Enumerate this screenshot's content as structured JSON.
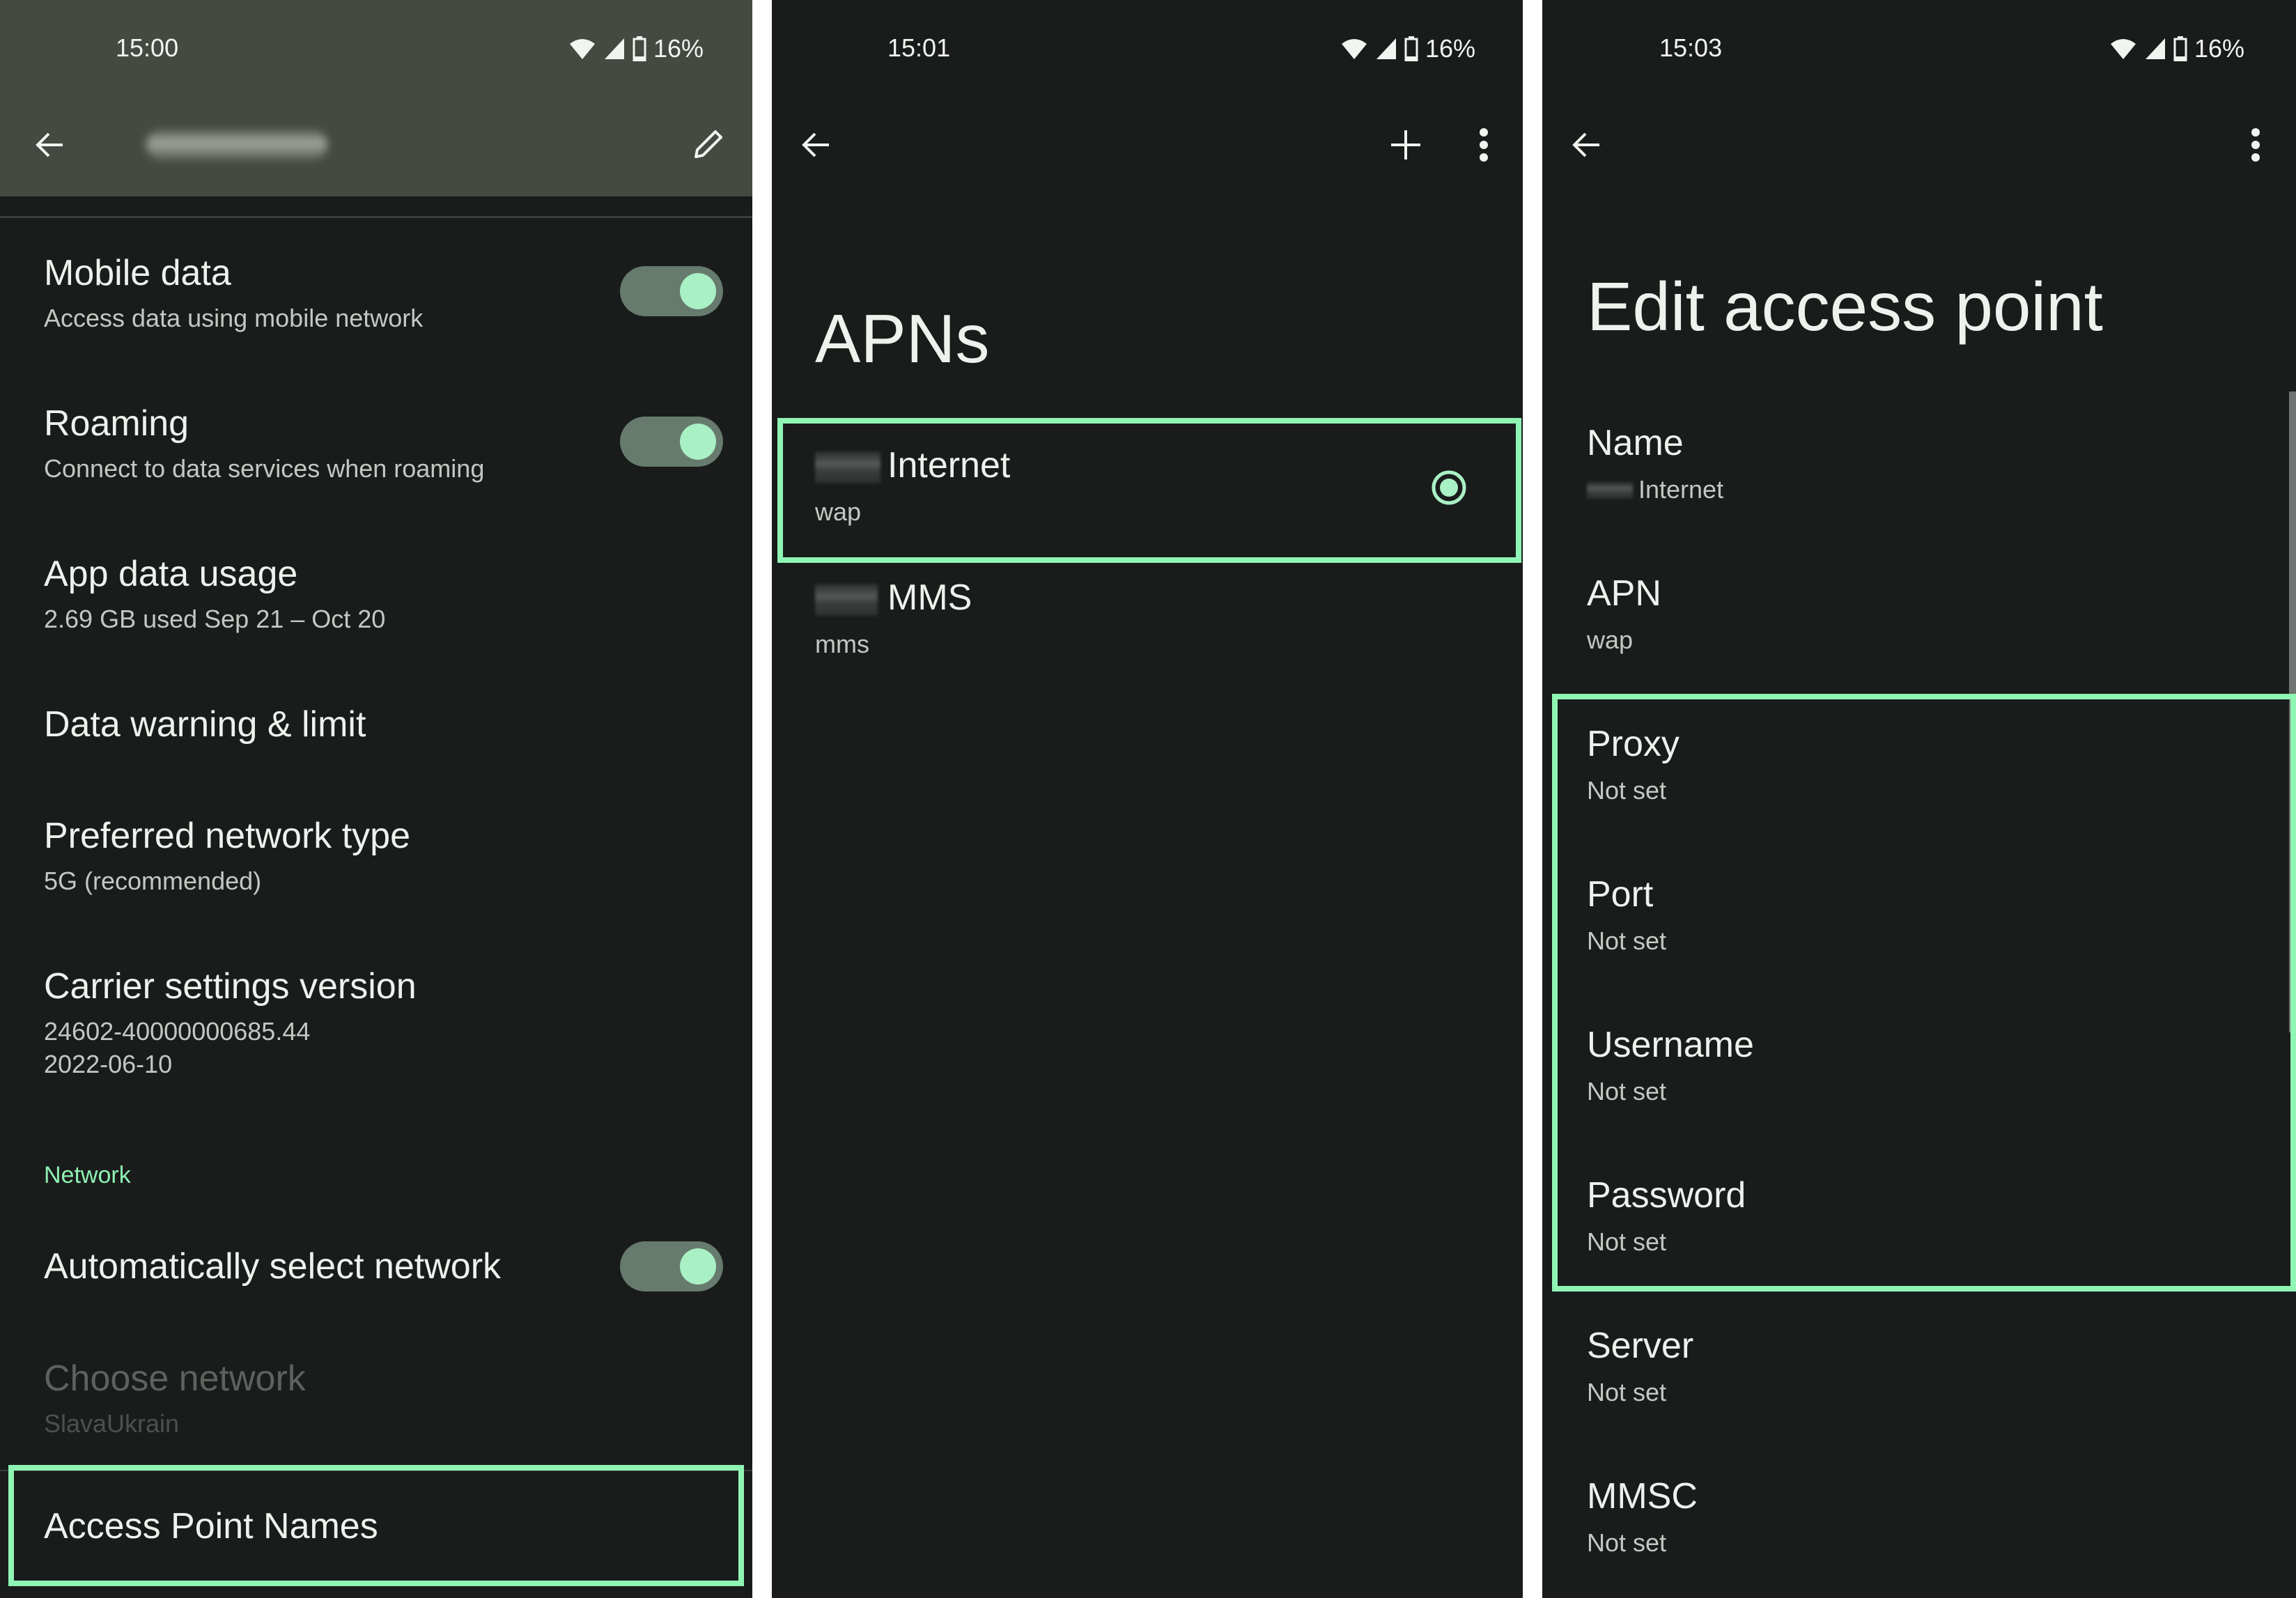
{
  "accent_color": "#8ff4b4",
  "screens": [
    {
      "status": {
        "time": "15:00",
        "battery": "16%"
      },
      "toolbar": {
        "back_icon": "arrow-back-icon",
        "title_redacted": true,
        "action_icon": "edit-pencil-icon"
      },
      "items": [
        {
          "title": "Mobile data",
          "subtitle": "Access data using mobile network",
          "toggle": true
        },
        {
          "title": "Roaming",
          "subtitle": "Connect to data services when roaming",
          "toggle": true
        },
        {
          "title": "App data usage",
          "subtitle": "2.69 GB used Sep 21 – Oct 20"
        },
        {
          "title": "Data warning & limit"
        },
        {
          "title": "Preferred network type",
          "subtitle": "5G (recommended)"
        },
        {
          "title": "Carrier settings version",
          "subtitle": "24602-40000000685.44",
          "subtitle2": "2022-06-10"
        }
      ],
      "section_header": "Network",
      "network_items": [
        {
          "title": "Automatically select network",
          "toggle": true
        },
        {
          "title": "Choose network",
          "subtitle": "SlavaUkrain",
          "disabled": true
        },
        {
          "title": "Access Point Names",
          "highlighted": true
        }
      ]
    },
    {
      "status": {
        "time": "15:01",
        "battery": "16%"
      },
      "toolbar": {
        "back_icon": "arrow-back-icon",
        "add_icon": "plus-icon",
        "more_icon": "more-vert-icon"
      },
      "title": "APNs",
      "apns": [
        {
          "name": "Internet",
          "type": "wap",
          "selected": true,
          "highlighted": true
        },
        {
          "name": "MMS",
          "type": "mms",
          "selected": false
        }
      ]
    },
    {
      "status": {
        "time": "15:03",
        "battery": "16%"
      },
      "toolbar": {
        "back_icon": "arrow-back-icon",
        "more_icon": "more-vert-icon"
      },
      "title": "Edit access point",
      "fields": [
        {
          "label": "Name",
          "value": "Internet"
        },
        {
          "label": "APN",
          "value": "wap"
        },
        {
          "label": "Proxy",
          "value": "Not set"
        },
        {
          "label": "Port",
          "value": "Not set"
        },
        {
          "label": "Username",
          "value": "Not set"
        },
        {
          "label": "Password",
          "value": "Not set"
        },
        {
          "label": "Server",
          "value": "Not set"
        },
        {
          "label": "MMSC",
          "value": "Not set"
        }
      ]
    }
  ]
}
